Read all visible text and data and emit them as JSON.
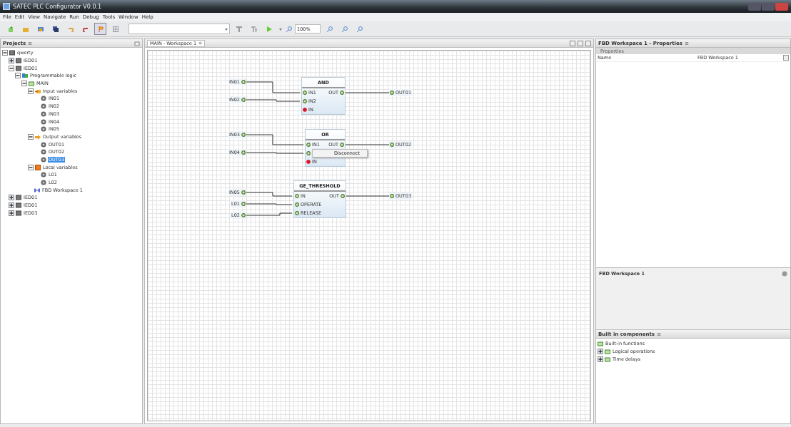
{
  "window": {
    "title": "SATEC PLC Configurator V0.0.1"
  },
  "menu": [
    "File",
    "Edit",
    "View",
    "Navigate",
    "Run",
    "Debug",
    "Tools",
    "Window",
    "Help"
  ],
  "toolbar": {
    "zoom": "100%"
  },
  "projects": {
    "title": "Projects",
    "tree": [
      {
        "label": "qwerty",
        "kind": "project",
        "expanded": true,
        "selected": false,
        "children": [
          {
            "label": "IED01",
            "kind": "device",
            "expanded": false,
            "selected": false
          },
          {
            "label": "IED01",
            "kind": "device",
            "expanded": true,
            "selected": false,
            "children": [
              {
                "label": "Programmable logic",
                "kind": "logic",
                "expanded": true,
                "selected": false,
                "children": [
                  {
                    "label": "MAIN",
                    "kind": "main",
                    "expanded": true,
                    "selected": false,
                    "children": [
                      {
                        "label": "Input variables",
                        "kind": "inputs",
                        "expanded": true,
                        "selected": false,
                        "children": [
                          {
                            "label": "IN01",
                            "kind": "variable",
                            "selected": false
                          },
                          {
                            "label": "IN02",
                            "kind": "variable",
                            "selected": false
                          },
                          {
                            "label": "IN03",
                            "kind": "variable",
                            "selected": false
                          },
                          {
                            "label": "IN04",
                            "kind": "variable",
                            "selected": false
                          },
                          {
                            "label": "IN05",
                            "kind": "variable",
                            "selected": false
                          }
                        ]
                      },
                      {
                        "label": "Output variables",
                        "kind": "outputs",
                        "expanded": true,
                        "selected": false,
                        "children": [
                          {
                            "label": "OUT01",
                            "kind": "variable",
                            "selected": false
                          },
                          {
                            "label": "OUT02",
                            "kind": "variable",
                            "selected": false
                          },
                          {
                            "label": "OUT03",
                            "kind": "variable",
                            "selected": true
                          }
                        ]
                      },
                      {
                        "label": "Local variables",
                        "kind": "locals",
                        "expanded": true,
                        "selected": false,
                        "children": [
                          {
                            "label": "L01",
                            "kind": "variable",
                            "selected": false
                          },
                          {
                            "label": "L02",
                            "kind": "variable",
                            "selected": false
                          }
                        ]
                      },
                      {
                        "label": "FBD Workspace 1",
                        "kind": "workspace",
                        "selected": false
                      }
                    ]
                  }
                ]
              }
            ]
          },
          {
            "label": "IED01",
            "kind": "device",
            "expanded": false,
            "selected": false
          },
          {
            "label": "IED01",
            "kind": "device",
            "expanded": false,
            "selected": false
          },
          {
            "label": "IED03",
            "kind": "device",
            "expanded": false,
            "selected": false
          }
        ]
      }
    ]
  },
  "editor": {
    "tab": "MAIN - Workspace 1",
    "groups": [
      {
        "sources": [
          "IN01",
          "IN02"
        ],
        "block": {
          "title": "AND",
          "inputs": [
            {
              "label": "IN1",
              "connected": true
            },
            {
              "label": "IN2",
              "connected": true
            },
            {
              "label": "IN",
              "connected": false
            }
          ],
          "output": "OUT"
        },
        "target": "OUT01"
      },
      {
        "sources": [
          "IN03",
          "IN04"
        ],
        "block": {
          "title": "OR",
          "inputs": [
            {
              "label": "IN1",
              "connected": true
            },
            {
              "connected": true
            },
            {
              "label": "IN",
              "connected": false
            }
          ],
          "output": "OUT"
        },
        "target": "OUT02",
        "menu": [
          "Disconnect"
        ]
      },
      {
        "sources": [
          "IN05",
          "L01",
          "L02"
        ],
        "block": {
          "title": "GE_THRESHOLD",
          "inputs": [
            {
              "label": "IN",
              "connected": true
            },
            {
              "label": "OPERATE",
              "connected": true
            },
            {
              "label": "RELEASE",
              "connected": true
            }
          ],
          "output": "OUT"
        },
        "target": "OUT03"
      }
    ]
  },
  "properties": {
    "title": "FBD Workspace 1 - Properties",
    "section": "Properties",
    "rows": [
      {
        "name": "Name",
        "value": "FBD Workspace 1"
      }
    ],
    "description": "FBD Workspace 1"
  },
  "components": {
    "title": "Built in components",
    "root": "Built-in functions",
    "children": [
      {
        "label": "Logical operations",
        "expanded": false
      },
      {
        "label": "Time delays",
        "expanded": false
      }
    ]
  }
}
